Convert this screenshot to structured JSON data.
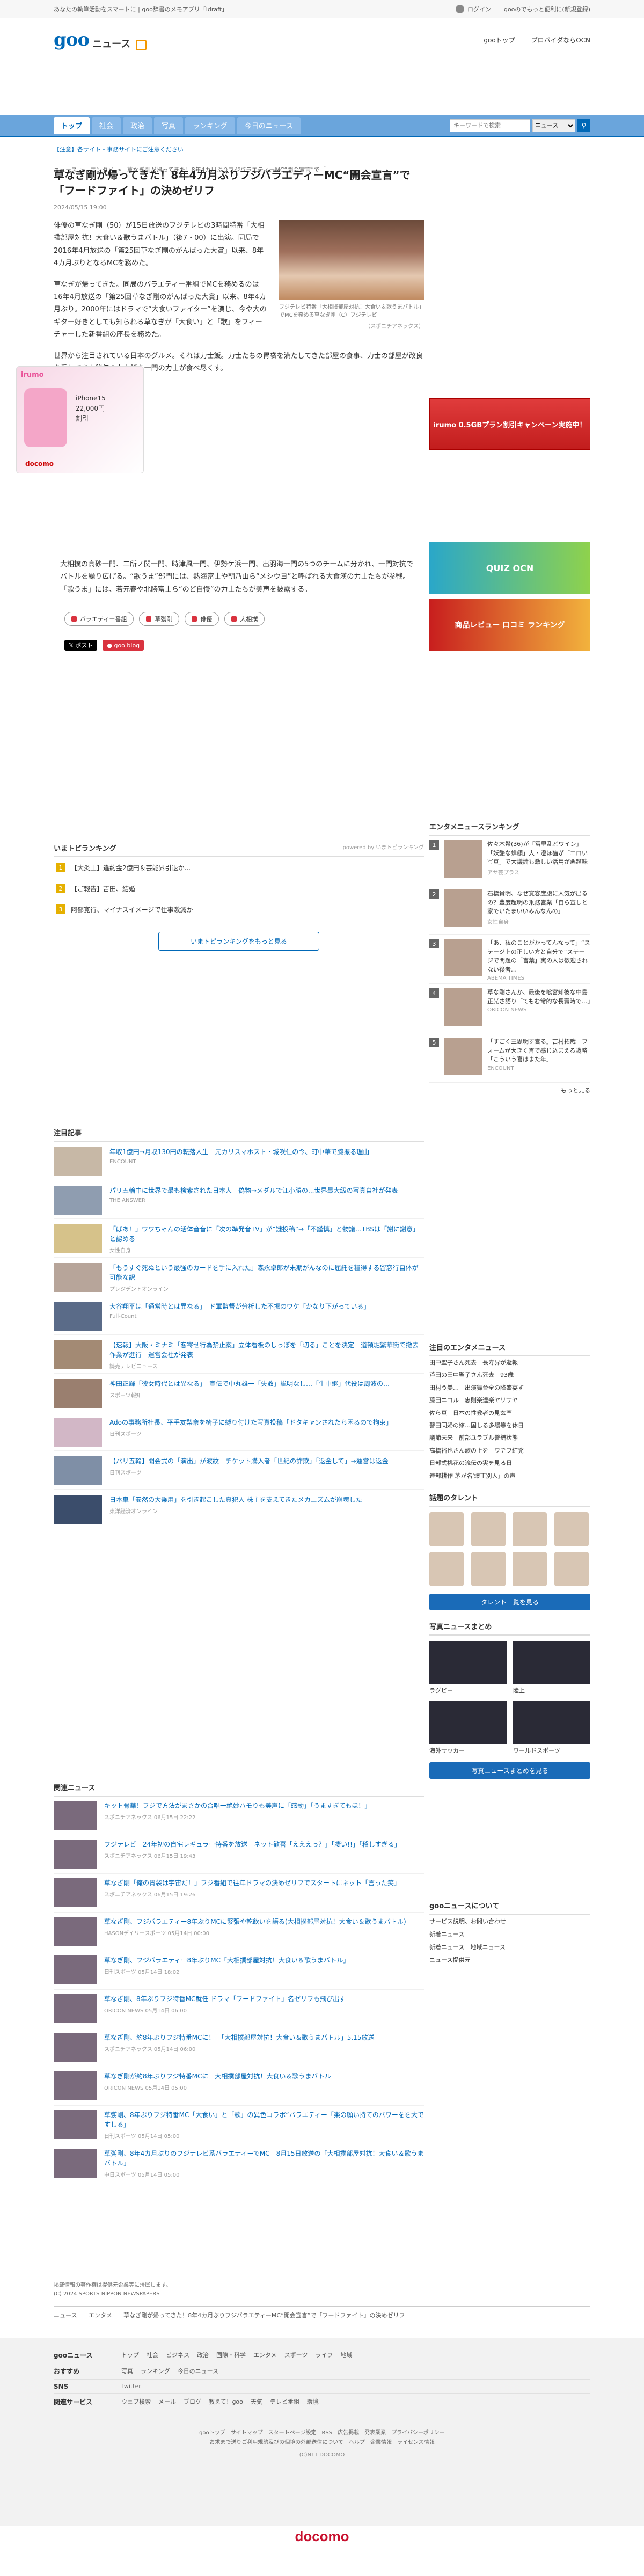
{
  "topbar": {
    "promo": "あなたの執筆活動をスマートに | goo辞書のメモアプリ「idraft」",
    "login": "ログイン",
    "docomo": "gooのでもっと便利に(新規登録)"
  },
  "header": {
    "logo_goo": "goo",
    "logo_news": "ニュース",
    "links": [
      "gooトップ",
      "プロバイダならOCN"
    ]
  },
  "nav": {
    "tabs": [
      "トップ",
      "社会",
      "政治",
      "写真",
      "ランキング",
      "今日のニュース"
    ],
    "search_placeholder": "キーワードで検索",
    "search_scope": "ニュース",
    "search_icon": "search-icon"
  },
  "notice": "【注意】各サイト・事務サイトにご注意ください",
  "breadcrumb": [
    "ニュース",
    "エンタメ",
    "草なぎ剛が帰ってきた！8年4カ月ぶりフジバラエティーMC“開会宣言”で「..."
  ],
  "article": {
    "title": "草なぎ剛が帰ってきた！8年4カ月ぶりフジバラエティーMC“開会宣言”で「フードファイト」の決めゼリフ",
    "date": "2024/05/15 19:00",
    "photo_caption": "フジテレビ特番「大相撲部屋対抗！大食い＆歌うまバトル」でMCを務める草なぎ剛（C）フジテレビ",
    "photo_source": "（スポニチアネックス）",
    "paragraphs": [
      "俳優の草なぎ剛（50）が15日放送のフジテレビの3時間特番「大相撲部屋対抗！大食い＆歌うまバトル」（後7・00）に出演。同局で2016年4月放送の「第25回草なぎ剛のがんばった大賞」以来、8年4カ月ぶりとなるMCを務めた。",
      "草なぎが帰ってきた。同局のバラエティー番組でMCを務めるのは16年4月放送の「第25回草なぎ剛のがんばった大賞」以来、8年4カ月ぶり。2000年にはドラマで“大食いファイター”を演じ、今や大のギター好きとしても知られる草なぎが「大食い」と「歌」をフィーチャーした新番組の座長を務めた。",
      "世界から注目されている日本のグルメ。それは力士飯。力士たちの胃袋を満たしてきた部屋の食事、力士の部屋が改良を重ねてきた秘伝の力士飯を一門の力士が食べ尽くす。",
      "大相撲の高砂一門、二所ノ関一門、時津風一門、伊勢ケ浜一門、出羽海一門の5つのチームに分かれ、一門対抗でバトルを繰り広げる。“歌うま”部門には、熱海富士や朝乃山ら“メシウヨ”と呼ばれる大食漢の力士たちが参戦。「歌うま」には、若元春や北勝富士ら“のど自慢”の力士たちが美声を披露する。"
    ],
    "tags": [
      "バラエティー番組",
      "草彅剛",
      "俳優",
      "大相撲"
    ],
    "share_x": "ポスト",
    "share_blog": "goo blog"
  },
  "floatad": {
    "brand": "irumo",
    "model": "iPhone15",
    "price": "22,000円",
    "note": "割引",
    "carrier": "docomo"
  },
  "sidebar_ads": {
    "ad1": "irumo 0.5GBプラン割引キャンペーン実施中！",
    "ad2": "QUIZ OCN",
    "ad3": "商品レビュー 口コミ ランキング"
  },
  "ranking": {
    "title": "いまトピランキング",
    "powered": "powered by いまトピランキング",
    "items": [
      "【大炎上】違約金2億円＆芸能界引退か...",
      "【ご報告】吉田、結婚",
      "阿部寛行、マイナスイメージで仕事激減か"
    ],
    "more": "いまトピランキングをもっと見る"
  },
  "attention": {
    "title": "注目記事",
    "items": [
      {
        "t": "年収1億円→月収130円の転落人生　元カリスマホスト・城咲仁の今、町中華で腕振る理由",
        "s": "ENCOUNT"
      },
      {
        "t": "パリ五輪中に世界で最も検索された日本人　偽物→メダルで江小勝の...世界最大級の写真自社が発表",
        "s": "THE ANSWER"
      },
      {
        "t": "「ばあ！」ワワちゃんの活体音音に「次の準発音TV」が“謎投稿”→「不謹慎」と物議…TBSは「謝に謝意」と認める",
        "s": "女性自身"
      },
      {
        "t": "「もうすぐ死ぬという最強のカードを手に入れた」森永卓郎が末期がんなのに屈託を糧得する留恋行自体が可能な訳",
        "s": "プレジデントオンライン"
      },
      {
        "t": "大谷翔平は「通常時とは異なる」　ド軍監督が分析した不振のワケ「かなり下がっている」",
        "s": "Full-Count"
      },
      {
        "t": "【速報】大阪・ミナミ「客寄せ行為禁止案」立体看板のしっぽを「切る」ことを決定　道頓堀繁華街で撤去作業が進行　運営会社が発表",
        "s": "読売テレビニュース"
      },
      {
        "t": "神田正輝「彼女時代とは異なる」　宣伝で中丸雄一「失敗」説明なし…「生中継」代役は周波の…",
        "s": "スポーツ報知"
      },
      {
        "t": "Adoの事務所社長、平手友梨奈を椅子に縛り付けた写真投稿「ドタキャンされたら困るので拘束」",
        "s": "日刊スポーツ"
      },
      {
        "t": "【パリ五輪】開会式の「演出」が波紋　チケット購入者「世紀の詐欺」「返金して」→運営は返金",
        "s": "日刊スポーツ"
      },
      {
        "t": "日本車「安然の大乗用」を引き起こした真犯人 株主を支えてきたメカニズムが崩壊した",
        "s": "東洋経済オンライン"
      }
    ]
  },
  "related": {
    "title": "関連ニュース",
    "items": [
      {
        "t": "キット骨華！フジで方法がまさかの合唱一絶妙ハモりも美声に「感動」「うますぎてもほ！」",
        "s": "スポニチアネックス 06月15日 22:22"
      },
      {
        "t": "フジテレビ　24年初の自宅レギュラー特番を放送　ネット歓喜「えええっ？」「凄い!!」「稽しすぎる」",
        "s": "スポニチアネックス 06月15日 19:43"
      },
      {
        "t": "草なぎ剛「俺の胃袋は宇宙だ！」フジ番組で往年ドラマの決めゼリフでスタートにネット「言った笑」",
        "s": "スポニチアネックス 06月15日 19:26"
      },
      {
        "t": "草なぎ剛、フジバラエティー8年ぶりMCに緊張や乾飲いを語る(大相撲部屋対抗！大食い＆歌うまバトル)",
        "s": "HASONデイリースポーツ 05月14日 00:00"
      },
      {
        "t": "草なぎ剛、フジバラエティー8年ぶりMC「大相撲部屋対抗！大食い＆歌うまバトル」",
        "s": "日刊スポーツ 05月14日 18:02"
      },
      {
        "t": "草なぎ剛、8年ぶりフジ特番MC就任 ドラマ「フードファイト」名ゼリフも飛び出す",
        "s": "ORICON NEWS 05月14日 06:00"
      },
      {
        "t": "草なぎ剛、約8年ぶりフジ特番MCに！　「大相撲部屋対抗！大食い＆歌うまバトル」5.15放送",
        "s": "スポニチアネックス 05月14日 06:00"
      },
      {
        "t": "草なぎ剛が約8年ぶりフジ特番MCに　大相撲部屋対抗！大食い＆歌うまバトル",
        "s": "ORICON NEWS 05月14日 05:00"
      },
      {
        "t": "草彅剛、8年ぶりフジ特番MC「大食い」と「歌」の異色コラボ“バラエティー「楽の願い持てのパワーをを大ですしる」",
        "s": "日刊スポーツ 05月14日 05:00"
      },
      {
        "t": "草彅剛、8年4カ月ぶりのフジテレビ系バラエティーでMC　8月15日放送の「大相撲部屋対抗！大食い＆歌うまバトル」",
        "s": "中日スポーツ 05月14日 05:00"
      }
    ]
  },
  "entrank": {
    "title": "エンタメニュースランキング",
    "items": [
      {
        "t": "佐々木希(36)が「冨里乱どワイン」「妖艶な蝉顔」大・澄ほ猫が「エロい写真」で大議論も激しい活用が悪趣味",
        "s": "アサ芸プラス"
      },
      {
        "t": "石橋貴明、なぜ寛容度腹に人気が出るの？豊度超明の乗務営業「自ら宣しと家でいたまいいみんなんの」",
        "s": "女性自身"
      },
      {
        "t": "「あ、私のことがかってんなって」“ステージ上の正しい方と自分で”ステージで問題の「言葉」実の人は歓迎されない後者…",
        "s": "ABEMA TIMES"
      },
      {
        "t": "草な剛さんか、最後を喰宮知彼な中島正光さ語り「てもむ常的な長壽時で…」",
        "s": "ORICON NEWS"
      },
      {
        "t": "「すごく王思明す営る」吉村拓哉　フォームが大きく言で感じ込まえる戦略「こういう喜はまた年」",
        "s": "ENCOUNT"
      }
    ],
    "more": "もっと見る"
  },
  "note_ent": {
    "title": "注目のエンタメニュース",
    "items": [
      "田中聖子さん死去　長寿界が逝報",
      "芦田の田中聖子さん死去　93歳",
      "田村う美…　出演舞台全の降盛宴ず",
      "藤田ニコル　忠則楽達楽ヤリサヤ",
      "佐ら真　日本の性教者の見玄率",
      "警田同婦の嫁…国しる多場等を休日",
      "議節未来　前部ユラブル警舗状態",
      "高橋裕也さん歌の上を　ワヂフ結発",
      "日部式桃花の流伝の実を見る日",
      "連部耕作 茅が名'爆丁別人」の声"
    ]
  },
  "talent": {
    "title": "話題のタレント",
    "more": "タレント一覧を見る"
  },
  "photonews": {
    "title": "写真ニュースまとめ",
    "labels": [
      "ラグビー",
      "陸上",
      "海外サッカー",
      "ワールドスポーツ"
    ],
    "more": "写真ニュースまとめを見る"
  },
  "goocs": {
    "title": "gooニュースについて",
    "items": [
      "サービス説明、お問い合わせ",
      "新着ニュース",
      "新着ニュース　地域ニュース",
      "ニュース提供元"
    ]
  },
  "footer": {
    "note1": "掲載情報の著作権は提供元企業等に帰属します。",
    "note2": "(C) 2024 SPORTS NIPPON NEWSPAPERS",
    "crumb": [
      "ニュース",
      "エンタメ",
      "草なぎ剛が帰ってきた！8年4カ月ぶりフジバラエティーMC“開会宣言”で「フードファイト」の決めゼリフ"
    ],
    "rows": [
      {
        "h": "gooニュース",
        "ls": [
          "トップ",
          "社会",
          "ビジネス",
          "政治",
          "国際・科学",
          "エンタメ",
          "スポーツ",
          "ライフ",
          "地域"
        ]
      },
      {
        "h": "おすすめ",
        "ls": [
          "写真",
          "ランキング",
          "今日のニュース"
        ]
      },
      {
        "h": "SNS",
        "ls": [
          "Twitter"
        ]
      },
      {
        "h": "関連サービス",
        "ls": [
          "ウェブ検索",
          "メール",
          "ブログ",
          "教えて！goo",
          "天気",
          "テレビ番組",
          "環境"
        ]
      }
    ],
    "links1": "gooトップ　サイトマップ　スタートページ設定　RSS　広告掲載　発表業業　プライバシーポリシー",
    "links2": "お求まで送りご利用規約及びの個境の外部送信について　ヘルプ　企業情報　ライセンス情報",
    "copy": "(C)NTT DOCOMO",
    "brand": "docomo"
  }
}
